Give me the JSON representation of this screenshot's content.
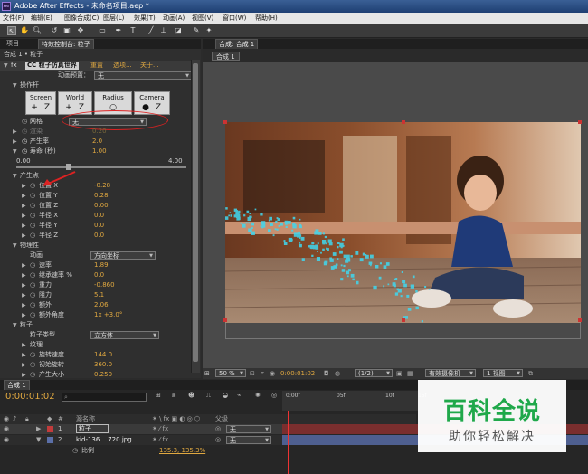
{
  "app": {
    "title": "Adobe After Effects - 未命名项目.aep *",
    "logo": "Ae"
  },
  "menu": [
    "文件(F)",
    "编辑(E)",
    "图像合成(C)",
    "图层(L)",
    "效果(T)",
    "动画(A)",
    "视图(V)",
    "窗口(W)",
    "帮助(H)"
  ],
  "toolbar": {
    "icons": [
      "selection-tool-icon",
      "hand-tool-icon",
      "zoom-tool-icon",
      "rotate-tool-icon",
      "camera-tool-icon",
      "pan-behind-tool-icon",
      "rectangle-tool-icon",
      "pen-tool-icon",
      "type-tool-icon",
      "brush-tool-icon",
      "clone-stamp-tool-icon",
      "eraser-tool-icon",
      "roto-brush-tool-icon",
      "puppet-tool-icon"
    ]
  },
  "left_panel": {
    "tab_project": "项目",
    "tab_effects": "特效控制台: 粒子",
    "breadcrumb": "合成 1 • 粒子",
    "effect": {
      "fx": "fx",
      "name": "CC 粒子仿真世界",
      "reset": "重置",
      "options": "选项...",
      "about": "关于...",
      "preset_label": "动画预置：",
      "preset_value": "无"
    },
    "grid_section": "操作杆",
    "segments": [
      {
        "label": "Screen",
        "icons": [
          "+",
          "Z"
        ]
      },
      {
        "label": "World",
        "icons": [
          "+",
          "Z"
        ]
      },
      {
        "label": "Radius",
        "icons": [
          "○"
        ]
      },
      {
        "label": "Camera",
        "icons": [
          "●",
          "Z"
        ]
      }
    ],
    "grid_label": "网格",
    "grid_value": "无",
    "props_top": [
      {
        "label": "渲染",
        "value": "0.20"
      },
      {
        "label": "产生率",
        "value": "2.0"
      },
      {
        "label": "寿命 (秒)",
        "value": "1.00"
      }
    ],
    "slider": {
      "min": "0.00",
      "max": "4.00",
      "level": 0.25
    },
    "producer": {
      "title": "产生点",
      "items": [
        {
          "label": "位置 X",
          "value": "-0.28"
        },
        {
          "label": "位置 Y",
          "value": "0.28"
        },
        {
          "label": "位置 Z",
          "value": "0.00"
        },
        {
          "label": "半径 X",
          "value": "0.0"
        },
        {
          "label": "半径 Y",
          "value": "0.0"
        },
        {
          "label": "半径 Z",
          "value": "0.0"
        }
      ]
    },
    "physics": {
      "title": "物理性",
      "animation_label": "动画",
      "animation_value": "方向坐标",
      "items": [
        {
          "label": "速率",
          "value": "1.89"
        },
        {
          "label": "继承速率 %",
          "value": "0.0"
        },
        {
          "label": "重力",
          "value": "-0.860"
        },
        {
          "label": "阻力",
          "value": "5.1"
        },
        {
          "label": "额外",
          "value": "2.06"
        },
        {
          "label": "额外角度",
          "value": "1x +3.0°"
        }
      ]
    },
    "particle": {
      "title": "粒子",
      "type_label": "粒子类型",
      "type_value": "立方体",
      "texture": "纹理",
      "items": [
        {
          "label": "旋转速度",
          "value": "144.0"
        },
        {
          "label": "初始旋转",
          "value": "360.0"
        },
        {
          "label": "产生大小",
          "value": "0.250"
        }
      ]
    }
  },
  "comp_panel": {
    "tab": "合成: 合成 1",
    "subtab": "合成 1",
    "zoom": "50 %",
    "timecode": "0:00:01:02",
    "resolution": "(1/2)",
    "camera": "有效摄像机",
    "views": "1 视图"
  },
  "timeline": {
    "tab": "合成 1",
    "timecode": "0:00:01:02",
    "search_placeholder": "",
    "col_source": "源名称",
    "col_parent": "父级",
    "ruler": [
      "0:00f",
      "05f",
      "10f",
      "15f"
    ],
    "layers": [
      {
        "num": "1",
        "name": "粒子",
        "parent": "无",
        "color": "#c23b3b"
      },
      {
        "num": "2",
        "name": "kid-136....720.jpg",
        "parent": "无",
        "color": "#5b6fa8"
      }
    ],
    "sub_label": "比例",
    "sub_value": "135.3, 135.3%"
  },
  "watermark": {
    "line1": "百科全说",
    "line2": "助你轻松解决"
  },
  "colors": {
    "value_orange": "#e0a840",
    "accent_red": "#d22",
    "title_blue": "#2a4f88",
    "particle_cyan": "#3fd8f0"
  }
}
